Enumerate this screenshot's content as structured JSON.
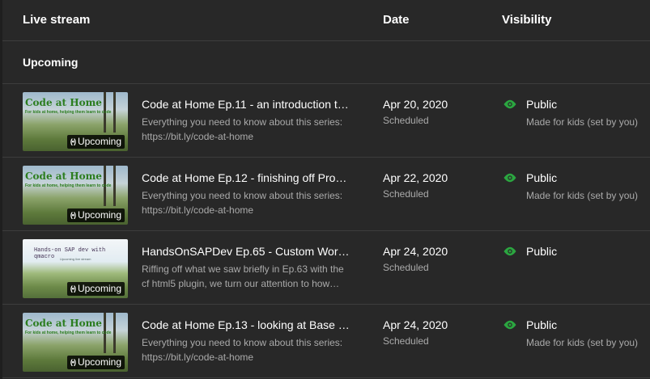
{
  "header": {
    "col_stream": "Live stream",
    "col_date": "Date",
    "col_visibility": "Visibility"
  },
  "section": {
    "label": "Upcoming"
  },
  "thumb_text": {
    "cah_title": "Code at Home",
    "cah_sub": "For kids at home, helping them learn to code",
    "sap_title": "Hands-on SAP dev with qmacro",
    "sap_sub": "Upcoming live stream"
  },
  "rows": [
    {
      "badge": "Upcoming",
      "title": "Code at Home Ep.11 - an introduction t…",
      "desc1": "Everything you need to know about this series:",
      "desc2": "https://bit.ly/code-at-home",
      "date": "Apr 20, 2020",
      "status": "Scheduled",
      "visibility": "Public",
      "audience": "Made for kids (set by you)"
    },
    {
      "badge": "Upcoming",
      "title": "Code at Home Ep.12 - finishing off Pro…",
      "desc1": "Everything you need to know about this series:",
      "desc2": "https://bit.ly/code-at-home",
      "date": "Apr 22, 2020",
      "status": "Scheduled",
      "visibility": "Public",
      "audience": "Made for kids (set by you)"
    },
    {
      "badge": "Upcoming",
      "title": "HandsOnSAPDev Ep.65 - Custom Wor…",
      "desc1": "Riffing off what we saw briefly in Ep.63 with the",
      "desc2": "cf html5 plugin, we turn our attention to how…",
      "date": "Apr 24, 2020",
      "status": "Scheduled",
      "visibility": "Public",
      "audience": ""
    },
    {
      "badge": "Upcoming",
      "title": "Code at Home Ep.13 - looking at Base …",
      "desc1": "Everything you need to know about this series:",
      "desc2": "https://bit.ly/code-at-home",
      "date": "Apr 24, 2020",
      "status": "Scheduled",
      "visibility": "Public",
      "audience": "Made for kids (set by you)"
    }
  ],
  "colors": {
    "background": "#282828",
    "divider": "#3d3d3d",
    "text_primary": "#ffffff",
    "text_secondary": "#aaaaaa",
    "public_icon": "#2ba640"
  },
  "icons": {
    "badge": "live-broadcast-icon",
    "visibility": "eye-icon"
  }
}
